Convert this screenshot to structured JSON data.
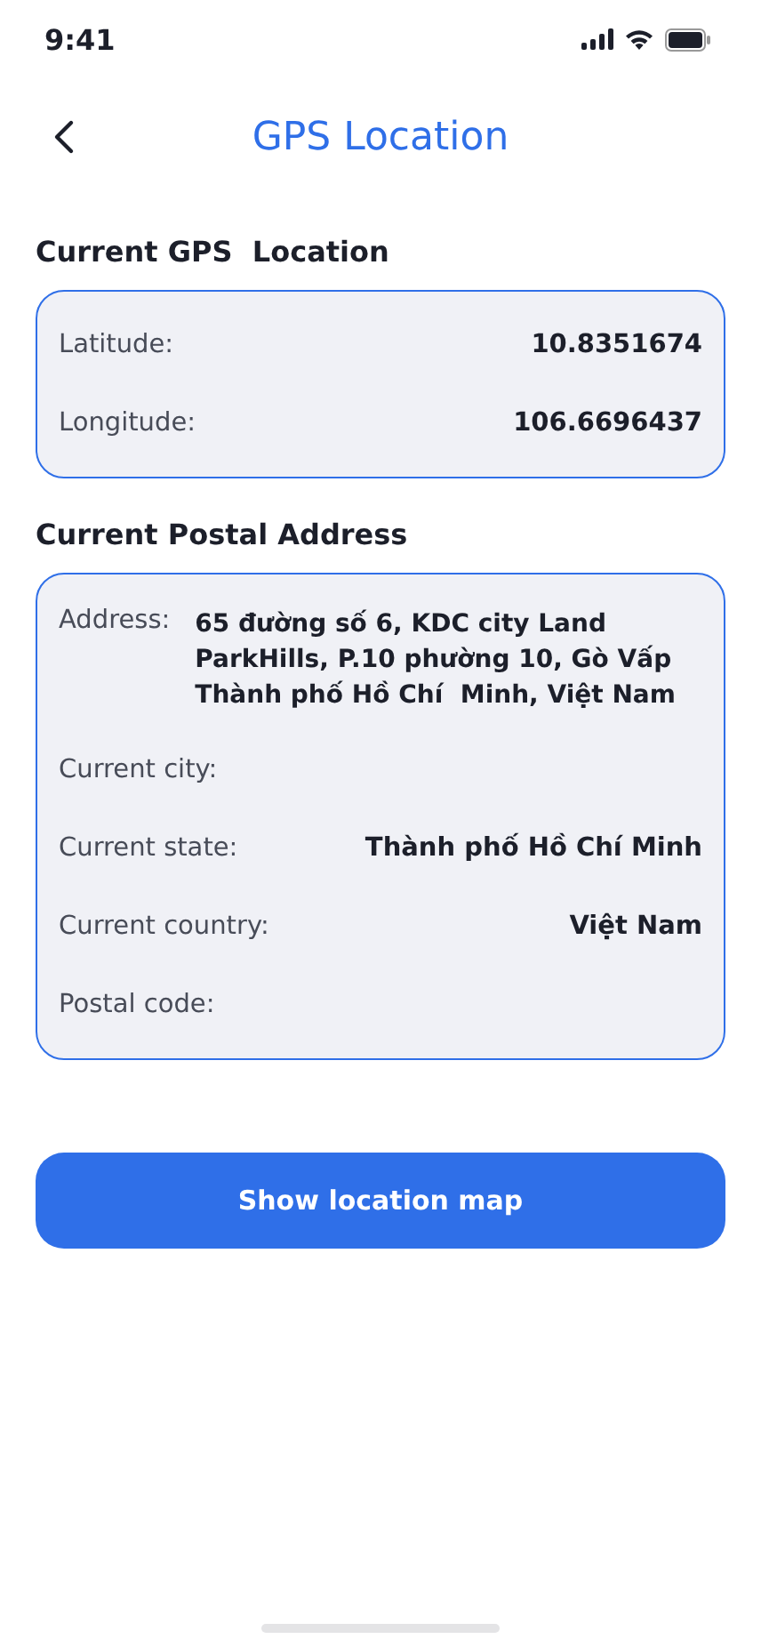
{
  "status_bar": {
    "time": "9:41"
  },
  "header": {
    "title": "GPS Location"
  },
  "gps": {
    "heading": "Current GPS  Location",
    "rows": [
      {
        "label": "Latitude:",
        "value": "10.8351674"
      },
      {
        "label": "Longitude:",
        "value": "106.6696437"
      }
    ]
  },
  "postal": {
    "heading": "Current Postal Address",
    "rows": [
      {
        "kind": "block",
        "label": "Address:",
        "value": "65 đường số 6, KDC city Land ParkHills, P.10 phường 10, Gò Vấp Thành phố Hồ Chí  Minh, Việt Nam"
      },
      {
        "kind": "inline",
        "label": "Current city:"
      },
      {
        "kind": "inline",
        "label": "Current state:",
        "value": "Thành phố Hồ Chí Minh"
      },
      {
        "kind": "inline",
        "label": "Current country:",
        "value": "Việt Nam"
      },
      {
        "kind": "inline",
        "label": "Postal code:"
      }
    ]
  },
  "button": {
    "label": "Show location map"
  }
}
